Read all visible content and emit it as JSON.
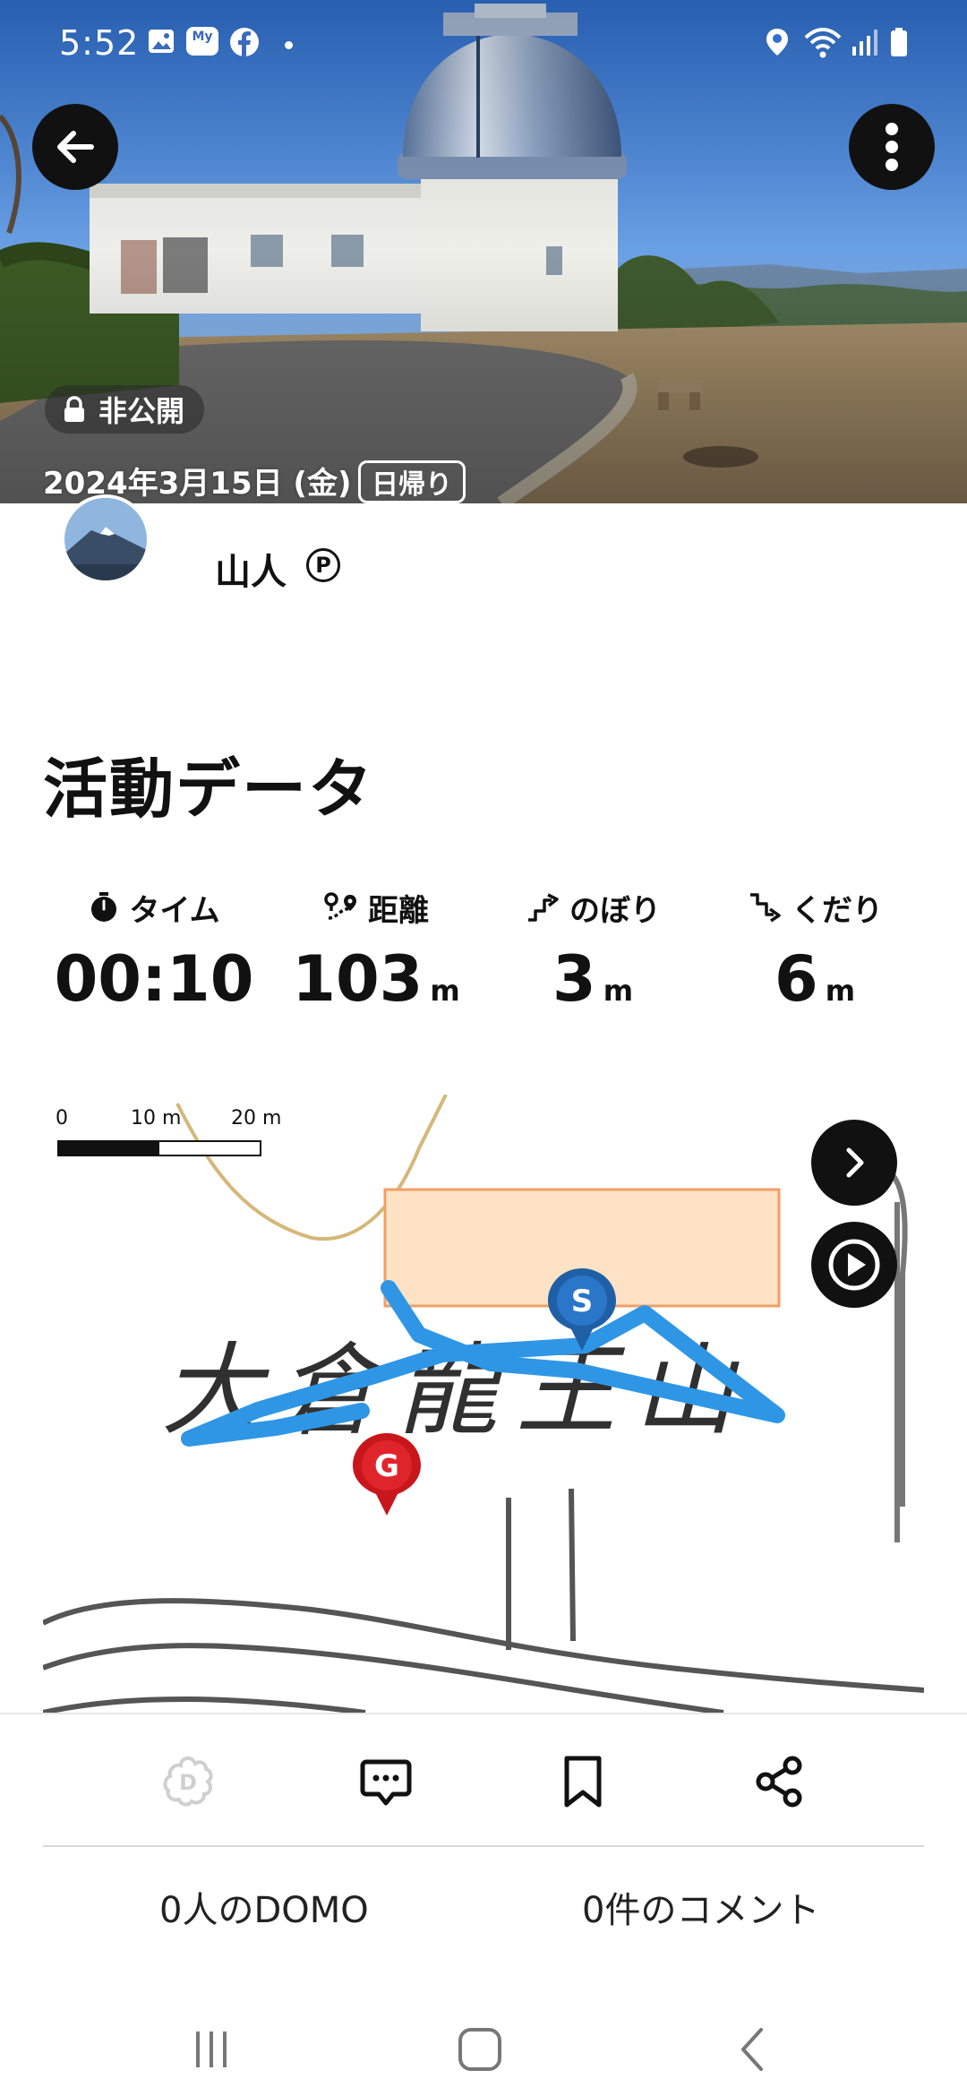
{
  "status_bar": {
    "time": "5:52",
    "icons": [
      "gallery-icon",
      "my-docomo-icon",
      "facebook-icon",
      "dot-icon",
      "location-icon",
      "wifi-icon",
      "signal-icon",
      "battery-icon"
    ],
    "docomo_label": "My"
  },
  "header": {
    "back_icon": "arrow-left-icon",
    "menu_icon": "more-vertical-icon",
    "visibility_label": "非公開",
    "date": "2024年3月15日 (金)",
    "trip_type": "日帰り"
  },
  "user": {
    "name": "山人",
    "badge": "P"
  },
  "activity": {
    "title": "活動データ",
    "stats": [
      {
        "icon": "stopwatch-icon",
        "label": "タイム",
        "value": "00:10",
        "unit": ""
      },
      {
        "icon": "route-icon",
        "label": "距離",
        "value": "103",
        "unit": "m"
      },
      {
        "icon": "ascent-icon",
        "label": "のぼり",
        "value": "3",
        "unit": "m"
      },
      {
        "icon": "descent-icon",
        "label": "くだり",
        "value": "6",
        "unit": "m"
      }
    ]
  },
  "map": {
    "scale_labels": [
      "0",
      "10 m",
      "20 m"
    ],
    "place_name": "大倉龍王山",
    "start_marker": "S",
    "goal_marker": "G",
    "track_color": "#2f96e6",
    "next_icon": "chevron-right-icon",
    "play_icon": "play-icon"
  },
  "actions": [
    {
      "name": "domo-button",
      "icon": "domo-icon"
    },
    {
      "name": "comment-button",
      "icon": "comment-icon"
    },
    {
      "name": "bookmark-button",
      "icon": "bookmark-icon"
    },
    {
      "name": "share-button",
      "icon": "share-icon"
    }
  ],
  "counts": {
    "domo": "0人のDOMO",
    "comments": "0件のコメント"
  },
  "nav": [
    "recent-apps-icon",
    "home-icon",
    "back-icon"
  ]
}
